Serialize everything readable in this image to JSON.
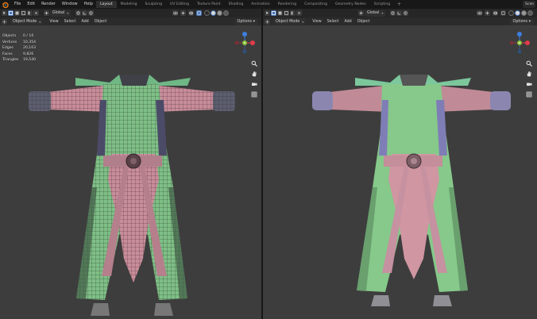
{
  "menubar": {
    "items": [
      "File",
      "Edit",
      "Render",
      "Window",
      "Help"
    ],
    "workspaces": [
      "Layout",
      "Modeling",
      "Sculpting",
      "UV Editing",
      "Texture Paint",
      "Shading",
      "Animation",
      "Rendering",
      "Compositing",
      "Geometry Nodes",
      "Scripting"
    ],
    "active_workspace": "Layout",
    "add_tab": "+",
    "scene": "Scen"
  },
  "viewport_left": {
    "orientation": "Global",
    "options": "Options",
    "mode": "Object Mode",
    "menus": [
      "View",
      "Select",
      "Add",
      "Object"
    ],
    "stats": [
      {
        "label": "Objects",
        "value": "0 / 10"
      },
      {
        "label": "Vertices",
        "value": "10,354"
      },
      {
        "label": "Edges",
        "value": "20,163"
      },
      {
        "label": "Faces",
        "value": "9,826"
      },
      {
        "label": "Triangles",
        "value": "19,540"
      }
    ],
    "overlay": "wireframe"
  },
  "viewport_right": {
    "orientation": "Global",
    "options": "Options",
    "mode": "Object Mode",
    "menus": [
      "View",
      "Select",
      "Add",
      "Object"
    ],
    "overlay": "solid"
  },
  "colors": {
    "background": "#3d3d3d",
    "header": "#262626",
    "accent": "#4772b3",
    "robe_green": "#7fbf86",
    "robe_pink": "#c88d9a",
    "sleeve": "#c48a96",
    "cuff": "#6f6f86",
    "axis_x": "#e23c4a",
    "axis_y": "#86c034",
    "axis_z": "#3d7fe0"
  },
  "icons": {
    "gizmo_x": "X",
    "gizmo_y": "Y",
    "gizmo_z": "Z"
  }
}
